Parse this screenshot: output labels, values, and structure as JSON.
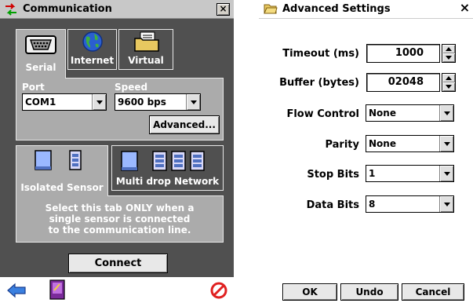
{
  "communication": {
    "title": "Communication",
    "close_label": "×",
    "tabs": [
      {
        "label": "Serial",
        "icon": "serial-port-icon",
        "active": true
      },
      {
        "label": "Internet",
        "icon": "globe-icon",
        "active": false
      },
      {
        "label": "Virtual",
        "icon": "folder-icon",
        "active": false
      }
    ],
    "port_label": "Port",
    "port_value": "COM1",
    "speed_label": "Speed",
    "speed_value": "9600 bps",
    "advanced_button": "Advanced...",
    "sensor_tabs": [
      {
        "label": "Isolated Sensor",
        "active": true
      },
      {
        "label": "Multi drop Network",
        "active": false
      }
    ],
    "info_lines": [
      "Select this tab ONLY when a",
      "single sensor is connected",
      "to the communication line."
    ],
    "connect_button": "Connect",
    "bottom_icons": [
      "back-arrow-icon",
      "book-icon",
      "stop-icon"
    ]
  },
  "advanced": {
    "title": "Advanced Settings",
    "close_label": "×",
    "timeout_label": "Timeout (ms)",
    "timeout_value": "1000",
    "buffer_label": "Buffer (bytes)",
    "buffer_value": "02048",
    "flow_label": "Flow Control",
    "flow_value": "None",
    "parity_label": "Parity",
    "parity_value": "None",
    "stop_label": "Stop Bits",
    "stop_value": "1",
    "data_label": "Data Bits",
    "data_value": "8",
    "ok_button": "OK",
    "undo_button": "Undo",
    "cancel_button": "Cancel"
  },
  "colors": {
    "panel_dark": "#505050",
    "panel_light": "#ababab",
    "button_face": "#e8e8e8"
  }
}
